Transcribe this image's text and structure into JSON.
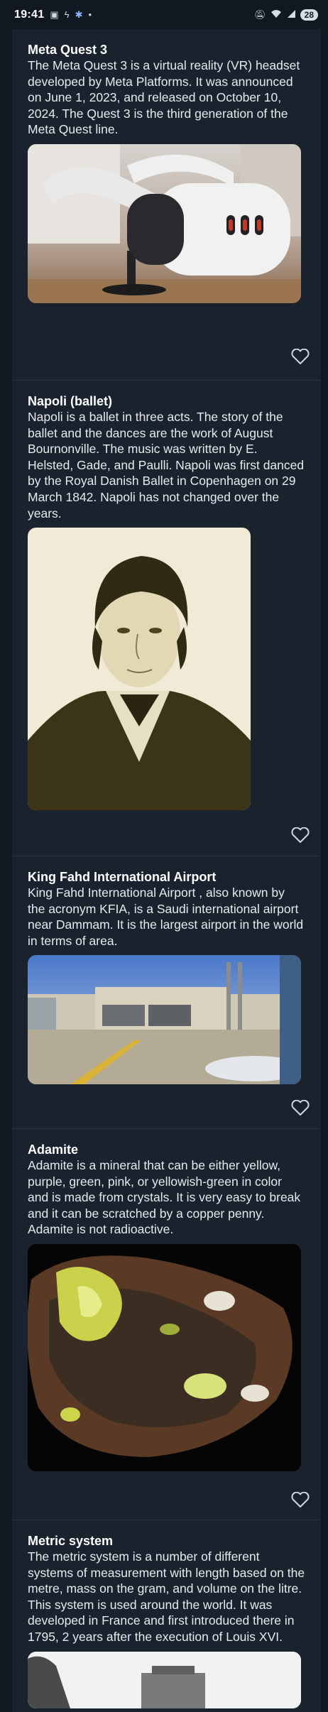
{
  "status_bar": {
    "time": "19:41",
    "battery": "28",
    "icons": [
      "screenshot-icon",
      "nfc-icon",
      "bluetooth-icon",
      "dot-icon",
      "mute-icon",
      "wifi-icon",
      "signal-icon"
    ]
  },
  "cards": [
    {
      "title": "Meta Quest 3",
      "text": "The Meta Quest 3 is a virtual reality (VR) headset developed by Meta Platforms. It was announced on June 1, 2023, and released on October 10, 2024. The Quest 3 is the third generation of the Meta Quest line.",
      "image_subject": "vr-headset"
    },
    {
      "title": "Napoli (ballet)",
      "text": "Napoli is a ballet in three acts. The story of the ballet and the dances are the work of August Bournonville. The music was written by E. Helsted, Gade, and Paulli. Napoli was first danced by the Royal Danish Ballet in Copenhagen on 29 March 1842. Napoli has not changed over the years.",
      "image_subject": "portrait-engraving"
    },
    {
      "title": "King Fahd International Airport",
      "text": "King Fahd International Airport , also known by the acronym KFIA, is a Saudi international airport near Dammam. It is the largest airport in the world in terms of area.",
      "image_subject": "airport-terminal"
    },
    {
      "title": "Adamite",
      "text": "Adamite is a mineral that can be either yellow, purple, green, pink, or yellowish-green in color and is made from crystals. It is very easy to break and it can be scratched by a copper penny. Adamite is not radioactive.",
      "image_subject": "mineral-specimen"
    },
    {
      "title": "Metric system",
      "text": "The metric system is a number of different systems of measurement with length based on the metre, mass on the gram, and volume on the litre. This system is used around the world. It was developed in France and first introduced there in 1795, 2 years after the execution of Louis XVI.",
      "image_subject": "historic-photo"
    }
  ],
  "colors": {
    "background": "#111822",
    "card": "#1a222d",
    "text": "#e6eaef",
    "heart_outline": "#cfd6de"
  }
}
